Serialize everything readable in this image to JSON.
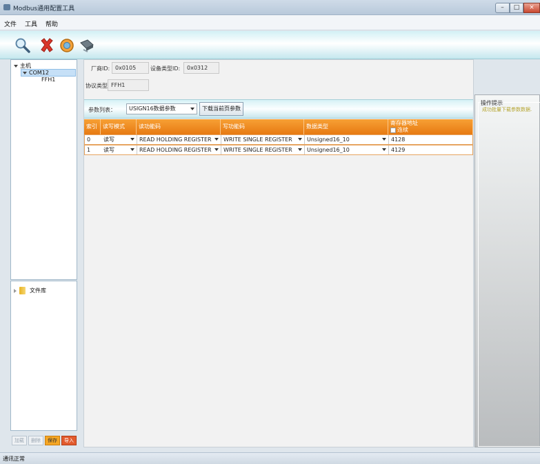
{
  "window": {
    "title": "Modbus通用配置工具",
    "controls": [
      "–",
      "□",
      "×"
    ]
  },
  "menu": [
    "文件",
    "工具",
    "帮助"
  ],
  "toolbar": {
    "icons": [
      "search-icon",
      "delete-icon",
      "connect-icon",
      "download-icon"
    ]
  },
  "tree": {
    "root": "主机",
    "port": "COM12",
    "protocol": "FFH1"
  },
  "library": {
    "label": "文件库"
  },
  "bottom_buttons": [
    "加载",
    "删除",
    "保存",
    "导入"
  ],
  "device": {
    "vendor_label": "厂商ID:",
    "vendor_value": "0x0105",
    "type_label": "设备类型ID:",
    "type_value": "0x0312",
    "protocol_label": "协议类型:",
    "protocol_value": "FFH1"
  },
  "params": {
    "label": "参数列表：",
    "selected": "USIGN16数据参数",
    "download_button": "下载当前页参数"
  },
  "grid": {
    "headers": [
      "索引",
      "读写模式",
      "读功能码",
      "写功能码",
      "数据类型",
      "寄存器地址"
    ],
    "continuous_label": "连续",
    "rows": [
      {
        "index": "0",
        "mode": "读写",
        "read": "READ HOLDING REGISTER",
        "write": "WRITE SINGLE REGISTER",
        "type": "Unsigned16_10",
        "addr": "4128"
      },
      {
        "index": "1",
        "mode": "读写",
        "read": "READ HOLDING REGISTER",
        "write": "WRITE SINGLE REGISTER",
        "type": "Unsigned16_10",
        "addr": "4129"
      }
    ]
  },
  "hint": {
    "title": "操作提示",
    "message": "成功批量下载参数数据."
  },
  "status": {
    "text": "通讯正常"
  },
  "colors": {
    "accent": "#f08a1f",
    "hint_text": "#b6a532"
  }
}
